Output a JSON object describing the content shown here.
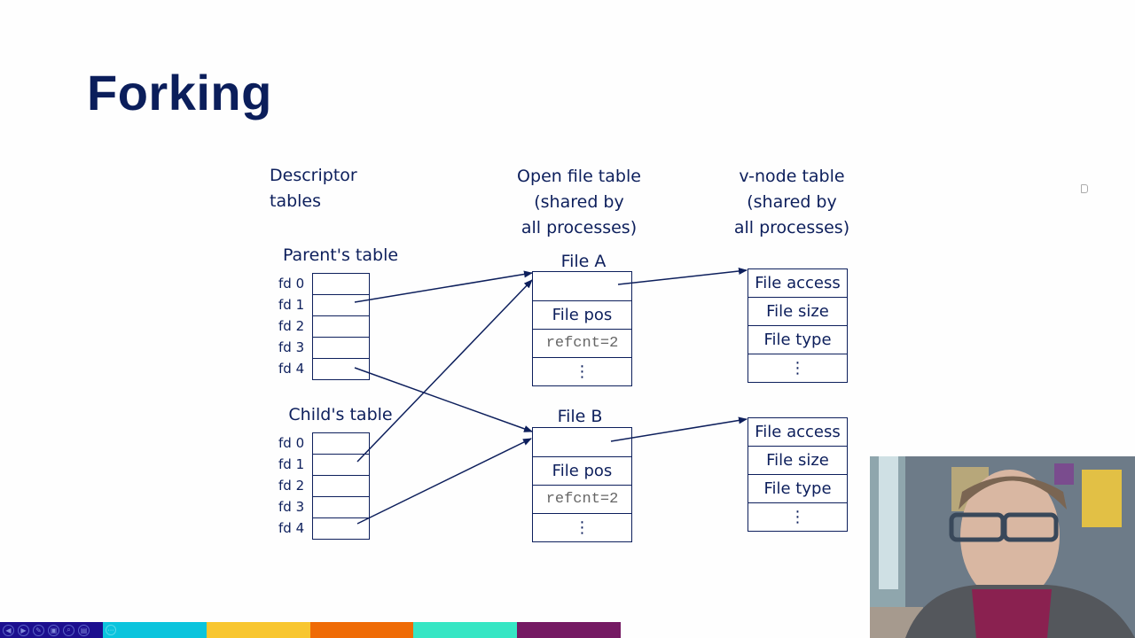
{
  "slide": {
    "title": "Forking",
    "columns": {
      "descriptor": [
        "Descriptor",
        "tables"
      ],
      "open_file": [
        "Open file table",
        "(shared by",
        "all processes)"
      ],
      "vnode": [
        "v-node table",
        "(shared by",
        "all processes)"
      ]
    },
    "parent_table": {
      "label": "Parent's table",
      "fds": [
        "fd 0",
        "fd 1",
        "fd 2",
        "fd 3",
        "fd 4"
      ]
    },
    "child_table": {
      "label": "Child's table",
      "fds": [
        "fd 0",
        "fd 1",
        "fd 2",
        "fd 3",
        "fd 4"
      ]
    },
    "open_files": [
      {
        "label": "File A",
        "rows": [
          "",
          "File pos",
          "refcnt=2",
          "⋮"
        ]
      },
      {
        "label": "File B",
        "rows": [
          "",
          "File pos",
          "refcnt=2",
          "⋮"
        ]
      }
    ],
    "vnodes": [
      {
        "rows": [
          "File access",
          "File size",
          "File type",
          "⋮"
        ]
      },
      {
        "rows": [
          "File access",
          "File size",
          "File type",
          "⋮"
        ]
      }
    ],
    "pointers": [
      {
        "from": "parent fd 1",
        "to": "File A"
      },
      {
        "from": "parent fd 4",
        "to": "File B"
      },
      {
        "from": "child fd 1",
        "to": "File A"
      },
      {
        "from": "child fd 4",
        "to": "File B"
      },
      {
        "from": "File A",
        "to": "v-node 1"
      },
      {
        "from": "File B",
        "to": "v-node 2"
      }
    ]
  },
  "toolbar": {
    "buttons": [
      "◀",
      "▶",
      "✎",
      "▣",
      "⌕",
      "▤"
    ],
    "more": "···"
  },
  "color_bar": [
    "#0bc4dd",
    "#f8c630",
    "#ef6b06",
    "#36e6c4",
    "#751a63"
  ],
  "colors": {
    "ink": "#0d1f5c",
    "title": "#0b1e5b"
  }
}
